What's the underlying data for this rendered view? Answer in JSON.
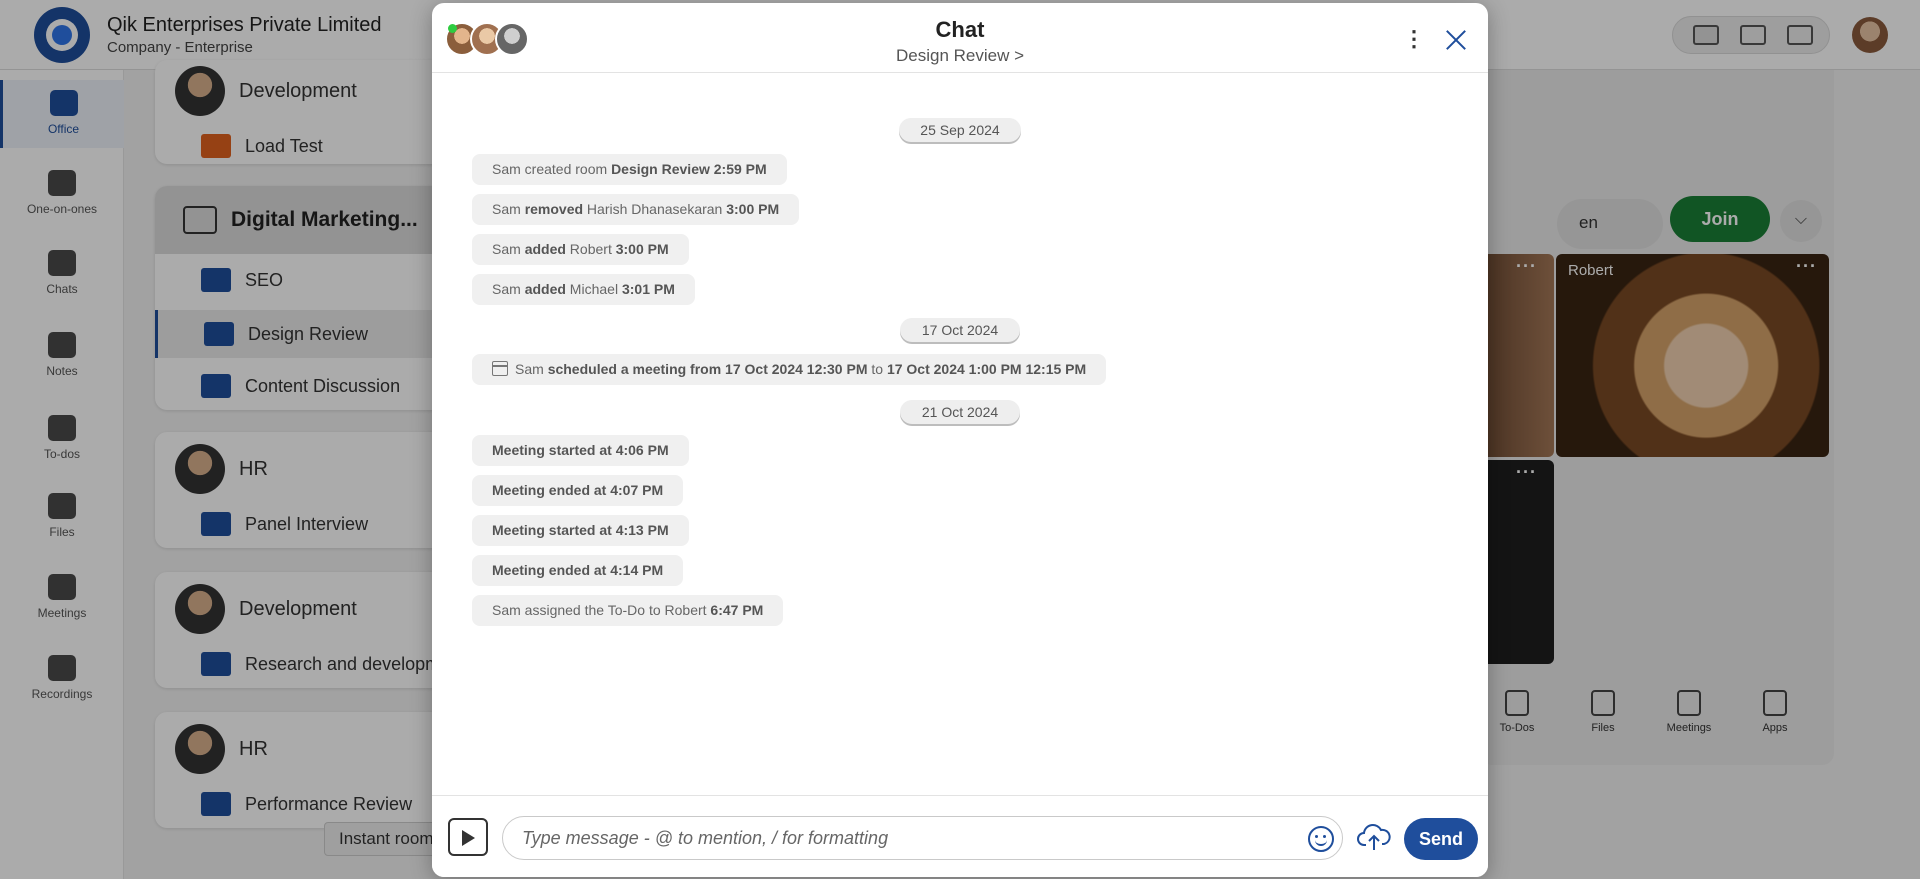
{
  "app": {
    "company_name": "Qik Enterprises Private Limited",
    "company_sub": "Company - Enterprise",
    "brand_color": "#1f4e9c"
  },
  "nav": {
    "items": [
      {
        "label": "Office",
        "icon": "briefcase-icon"
      },
      {
        "label": "One-on-ones",
        "icon": "people-icon"
      },
      {
        "label": "Chats",
        "icon": "chat-icon"
      },
      {
        "label": "Notes",
        "icon": "notes-icon"
      },
      {
        "label": "To-dos",
        "icon": "checkbox-icon"
      },
      {
        "label": "Files",
        "icon": "files-icon"
      },
      {
        "label": "Meetings",
        "icon": "meetings-icon"
      },
      {
        "label": "Recordings",
        "icon": "recordings-icon"
      }
    ]
  },
  "rooms": {
    "g1_name": "Development",
    "g1_room": "Load Test",
    "dm_name": "Digital Marketing...",
    "dm_rooms": [
      "SEO",
      "Design Review",
      "Content Discussion"
    ],
    "g2_name": "HR",
    "g2_room": "Panel Interview",
    "g3_name": "Development",
    "g3_room": "Research and developm",
    "g4_name": "HR",
    "g4_room": "Performance Review",
    "instant_tip": "Instant room"
  },
  "right_panel": {
    "lang": "en",
    "join_label": "Join",
    "tile_name": "Robert",
    "bottom_items": [
      "To-Dos",
      "Files",
      "Meetings",
      "Apps"
    ]
  },
  "chat": {
    "title": "Chat",
    "subtitle": "Design Review >",
    "input_placeholder": "Type message - @ to mention, / for formatting",
    "send_label": "Send",
    "dates": [
      "25 Sep 2024",
      "17 Oct 2024",
      "21 Oct 2024"
    ],
    "messages": {
      "m1": {
        "a": "Sam created room ",
        "b": "Design Review 2:59 PM"
      },
      "m2": {
        "a": "Sam ",
        "b": "removed",
        "c": " Harish Dhanasekaran ",
        "d": "3:00 PM"
      },
      "m3": {
        "a": "Sam ",
        "b": "added",
        "c": " Robert ",
        "d": "3:00 PM"
      },
      "m4": {
        "a": "Sam ",
        "b": "added",
        "c": " Michael ",
        "d": "3:01 PM"
      },
      "m5": {
        "a": "Sam ",
        "b": "scheduled a meeting from 17 Oct 2024 12:30 PM",
        "c": " to ",
        "d": "17 Oct 2024 1:00 PM 12:15 PM"
      },
      "m6": "Meeting started at 4:06 PM",
      "m7": "Meeting ended at 4:07 PM",
      "m8": "Meeting started at 4:13 PM",
      "m9": "Meeting ended at 4:14 PM",
      "m10": {
        "a": "Sam assigned the To-Do to Robert ",
        "b": "6:47 PM"
      }
    }
  }
}
